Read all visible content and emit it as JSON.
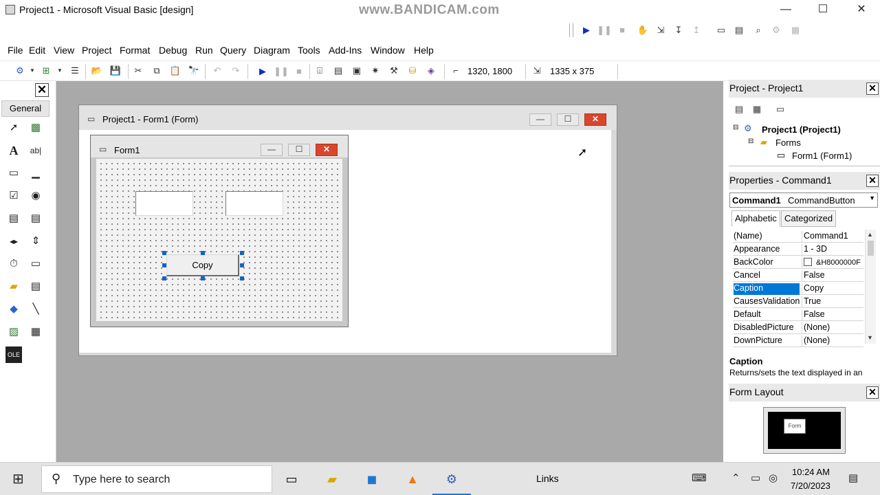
{
  "window": {
    "title": "Project1 - Microsoft Visual Basic [design]",
    "watermark": "www.BANDICAM.com",
    "controls": {
      "minimize": "—",
      "maximize": "☐",
      "close": "✕"
    }
  },
  "menu": [
    "File",
    "Edit",
    "View",
    "Project",
    "Format",
    "Debug",
    "Run",
    "Query",
    "Diagram",
    "Tools",
    "Add-Ins",
    "Window",
    "Help"
  ],
  "toolbar": {
    "position": "1320, 1800",
    "size": "1335 x 375"
  },
  "toolbox": {
    "close": "✕",
    "header": "General"
  },
  "designer": {
    "title": "Project1 - Form1 (Form)",
    "form": {
      "title": "Form1",
      "button_caption": "Copy"
    }
  },
  "project_panel": {
    "title": "Project - Project1",
    "close": "✕",
    "tree": {
      "root": "Project1 (Project1)",
      "folder": "Forms",
      "item": "Form1 (Form1)"
    }
  },
  "properties_panel": {
    "title": "Properties - Command1",
    "close": "✕",
    "object_name": "Command1",
    "object_type": "CommandButton",
    "tabs": [
      "Alphabetic",
      "Categorized"
    ],
    "rows": [
      {
        "name": "(Name)",
        "value": "Command1"
      },
      {
        "name": "Appearance",
        "value": "1 - 3D"
      },
      {
        "name": "BackColor",
        "value": "&H8000000F"
      },
      {
        "name": "Cancel",
        "value": "False"
      },
      {
        "name": "Caption",
        "value": "Copy"
      },
      {
        "name": "CausesValidation",
        "value": "True"
      },
      {
        "name": "Default",
        "value": "False"
      },
      {
        "name": "DisabledPicture",
        "value": "(None)"
      },
      {
        "name": "DownPicture",
        "value": "(None)"
      }
    ],
    "selected_row": "Caption",
    "description_title": "Caption",
    "description_text": "Returns/sets the text displayed in an"
  },
  "layout_panel": {
    "title": "Form Layout",
    "close": "✕",
    "mini_label": "Form"
  },
  "taskbar": {
    "search_placeholder": "Type here to search",
    "links": "Links",
    "time": "10:24 AM",
    "date": "7/20/2023"
  },
  "colors": {
    "selection": "#0078d7",
    "close_button": "#d8472d",
    "workspace": "#a9a9a9",
    "handle": "#1462c8"
  }
}
